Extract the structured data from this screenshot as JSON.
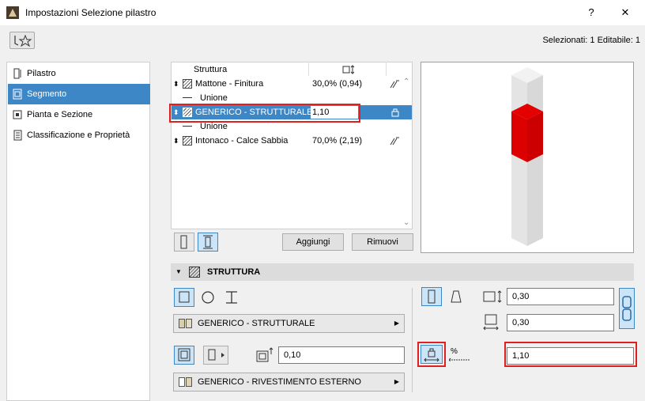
{
  "window": {
    "title": "Impostazioni Selezione pilastro",
    "help_label": "?",
    "close_label": "✕"
  },
  "header": {
    "selected_text": "Selezionati: 1 Editabile: 1"
  },
  "nav": {
    "items": [
      {
        "label": "Pilastro",
        "icon": "column-icon"
      },
      {
        "label": "Segmento",
        "icon": "segment-icon",
        "active": true
      },
      {
        "label": "Pianta e Sezione",
        "icon": "plan-section-icon"
      },
      {
        "label": "Classificazione e Proprietà",
        "icon": "classification-icon"
      }
    ]
  },
  "structure_list": {
    "header_name": "Struttura",
    "header_thickness_icon": "thickness-icon",
    "rows": [
      {
        "name": "Mattone - Finitura",
        "value": "30,0% (0,94)",
        "type": "skin"
      },
      {
        "name": "Unione",
        "value": "",
        "type": "separator"
      },
      {
        "name": "GENERICO - STRUTTURALE",
        "value": "1,10",
        "type": "skin",
        "selected": true
      },
      {
        "name": "Unione",
        "value": "",
        "type": "separator"
      },
      {
        "name": "Intonaco - Calce Sabbia",
        "value": "70,0% (2,19)",
        "type": "skin"
      }
    ],
    "add_label": "Aggiungi",
    "remove_label": "Rimuovi"
  },
  "section": {
    "title": "STRUTTURA",
    "material_top": "GENERICO - STRUTTURALE",
    "material_bottom": "GENERICO - RIVESTIMENTO ESTERNO",
    "veneer_thickness": "0,10",
    "width": "0,30",
    "depth": "0,30",
    "core_value": "1,10",
    "percent_label": "%"
  },
  "colors": {
    "accent": "#3d87c7",
    "highlight_red": "#e02020",
    "column_red": "#dd0000"
  }
}
